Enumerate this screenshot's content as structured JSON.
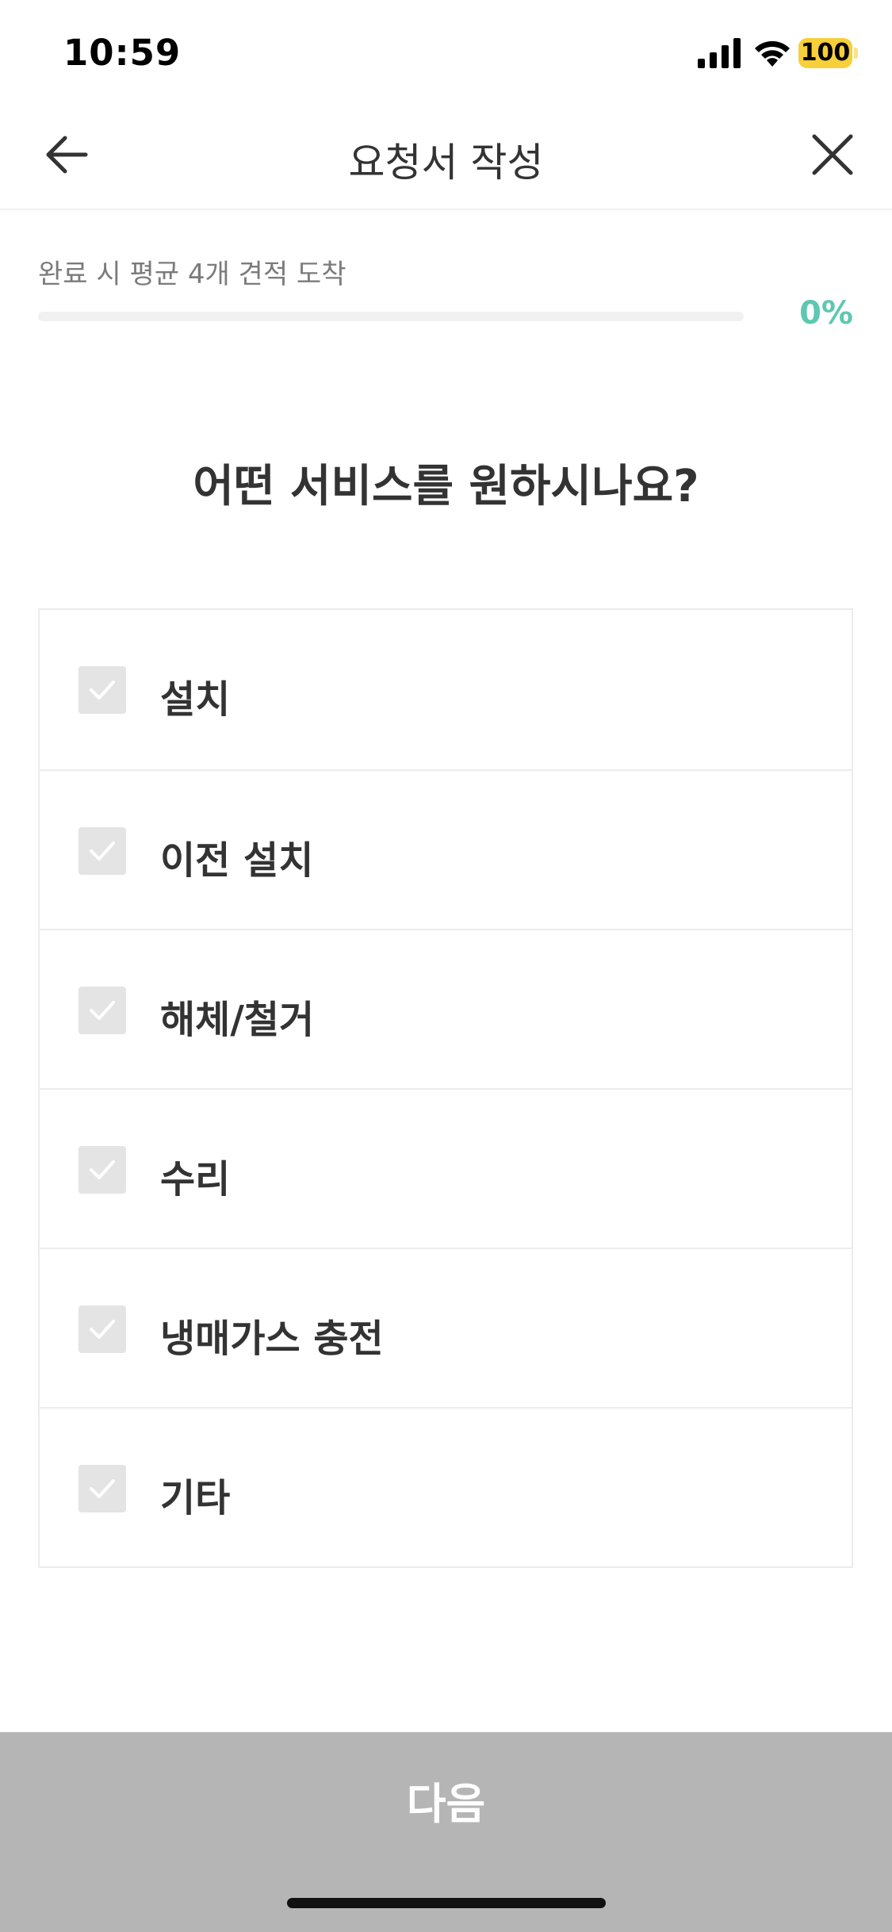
{
  "status_bar": {
    "time": "10:59",
    "battery": "100",
    "battery_color": "#f6cf3a"
  },
  "nav": {
    "title": "요청서 작성",
    "back_icon": "arrow-left-icon",
    "close_icon": "close-icon"
  },
  "progress": {
    "caption": "완료 시 평균 4개 견적 도착",
    "percent_text": "0%",
    "value": 0,
    "accent_color": "#5dc8b1"
  },
  "question": "어떤 서비스를 원하시나요?",
  "options": [
    {
      "label": "설치",
      "checked": false
    },
    {
      "label": "이전 설치",
      "checked": false
    },
    {
      "label": "해체/철거",
      "checked": false
    },
    {
      "label": "수리",
      "checked": false
    },
    {
      "label": "냉매가스 충전",
      "checked": false
    },
    {
      "label": "기타",
      "checked": false
    }
  ],
  "next_button": {
    "label": "다음",
    "enabled": false
  }
}
